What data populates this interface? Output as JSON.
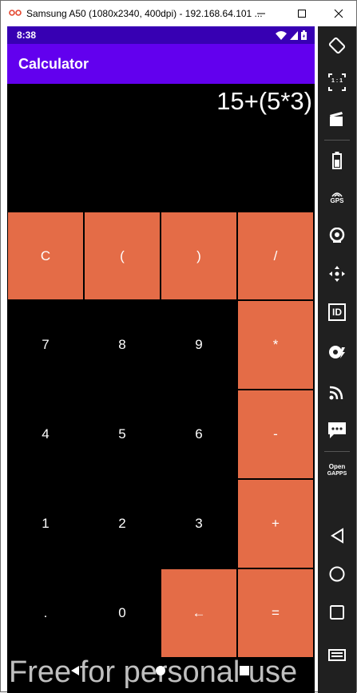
{
  "window": {
    "title": "Samsung A50 (1080x2340, 400dpi) - 192.168.64.101 ...",
    "controls": [
      "minimize-icon",
      "maximize-icon",
      "close-icon"
    ]
  },
  "status_bar": {
    "time": "8:38",
    "icons": [
      "wifi-icon",
      "signal-icon",
      "battery-icon"
    ]
  },
  "app_bar": {
    "title": "Calculator"
  },
  "display": {
    "expression": "15+(5*3)"
  },
  "keys": {
    "clear": "C",
    "open_paren": "(",
    "close_paren": ")",
    "divide": "/",
    "seven": "7",
    "eight": "8",
    "nine": "9",
    "multiply": "*",
    "four": "4",
    "five": "5",
    "six": "6",
    "minus": "-",
    "one": "1",
    "two": "2",
    "three": "3",
    "plus": "+",
    "dot": ".",
    "zero": "0",
    "backspace": "←",
    "equals": "="
  },
  "colors": {
    "operator_key": "#e46c47",
    "app_bar": "#6200ee",
    "status_bar": "#3700b3",
    "screen_background": "#000000"
  },
  "watermark": "Free for personal use",
  "sidebar": {
    "gps_label": "GPS",
    "open_gapps_line1": "Open",
    "open_gapps_line2": "GAPPS",
    "ratio_label": "1 : 1",
    "id_label": "ID",
    "icons": [
      "rotate-icon",
      "fit-screen-icon",
      "screenshot-icon",
      "battery-icon",
      "gps-icon",
      "webcam-icon",
      "dpad-icon",
      "id-icon",
      "media-icon",
      "cast-icon",
      "sms-icon",
      "open-gapps-icon",
      "back-icon",
      "home-icon",
      "recents-icon",
      "menu-icon"
    ]
  }
}
